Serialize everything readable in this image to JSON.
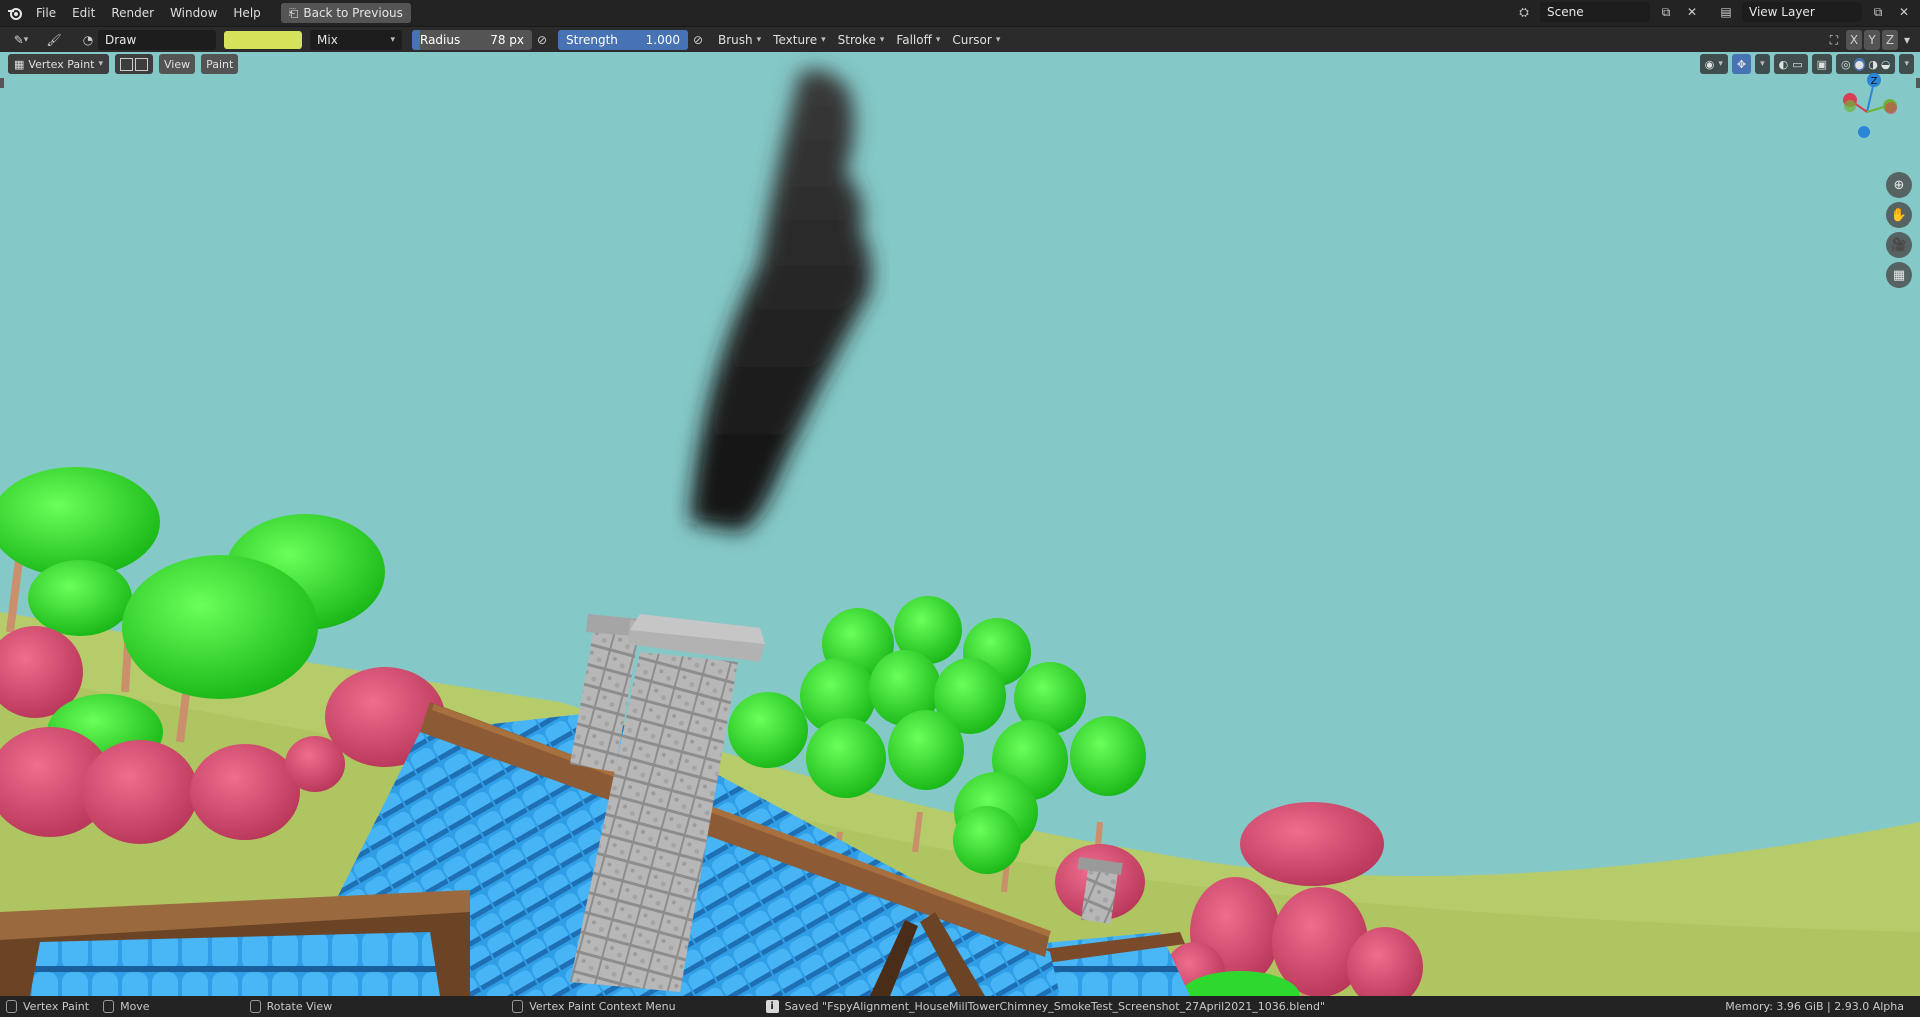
{
  "menu": {
    "items": [
      "File",
      "Edit",
      "Render",
      "Window",
      "Help"
    ],
    "back_button": "Back to Previous"
  },
  "topright": {
    "scene": "Scene",
    "view_layer": "View Layer"
  },
  "tool_header": {
    "tool_name": "Draw",
    "brush_color": "#d4e35a",
    "blend_mode": "Mix",
    "radius_label": "Radius",
    "radius_value": "78 px",
    "radius_fraction": 0.07,
    "strength_label": "Strength",
    "strength_value": "1.000",
    "strength_fraction": 1.0,
    "menus": [
      "Brush",
      "Texture",
      "Stroke",
      "Falloff",
      "Cursor"
    ]
  },
  "viewport_header": {
    "mode": "Vertex Paint",
    "view": "View",
    "paint": "Paint"
  },
  "gizmo": {
    "z": "Z"
  },
  "axes_buttons": [
    "X",
    "Y",
    "Z"
  ],
  "statusbar": {
    "left_mode": "Vertex Paint",
    "move": "Move",
    "rotate": "Rotate View",
    "context": "Vertex Paint Context Menu",
    "saved_msg": "Saved \"FspyAlignment_HouseMillTowerChimney_SmokeTest_Screenshot_27April2021_1036.blend\"",
    "memory": "Memory: 3.96 GiB | 2.93.0 Alpha"
  },
  "colors": {
    "sky": "#85c8c8",
    "roof": "#2e9be6",
    "tree_green": "#2fd82f",
    "tree_pink": "#d64a6c",
    "accent": "#4772b3"
  }
}
